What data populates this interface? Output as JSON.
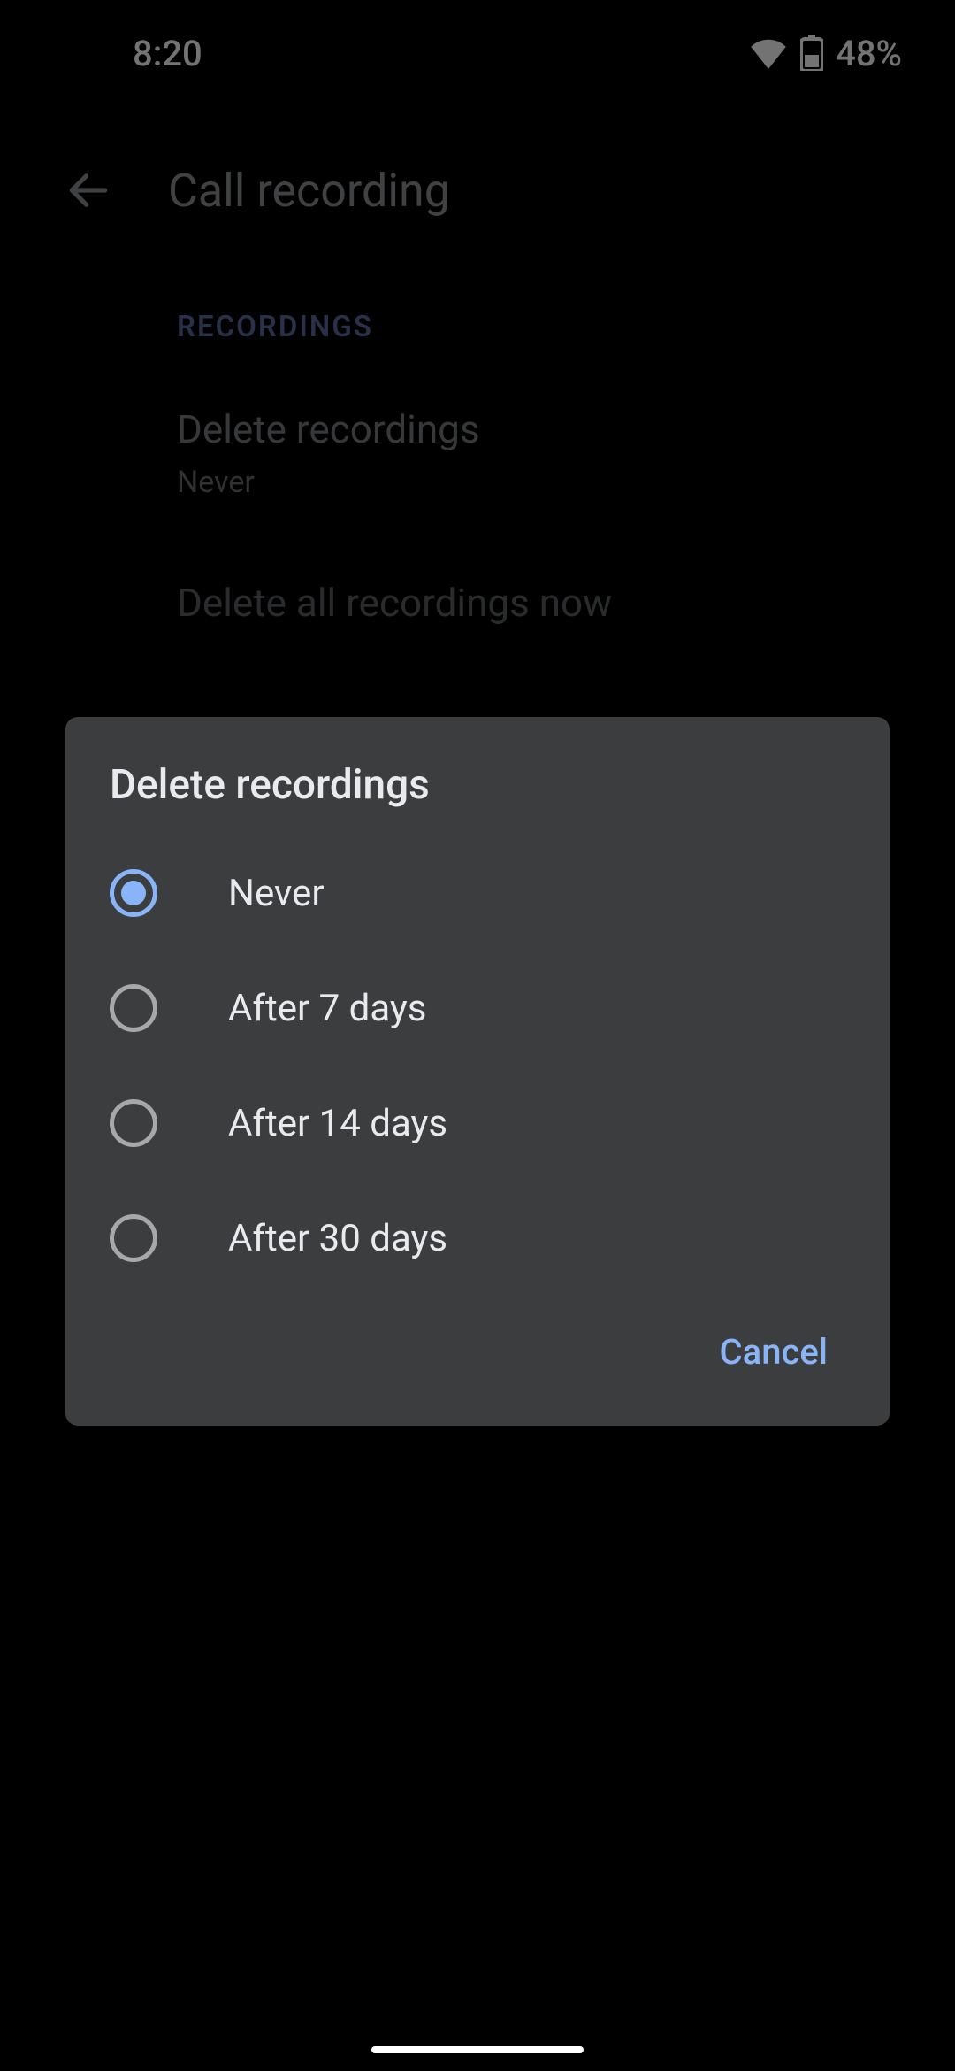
{
  "status": {
    "time": "8:20",
    "battery_pct": "48%"
  },
  "page": {
    "title": "Call recording",
    "section_header": "RECORDINGS",
    "items": [
      {
        "title": "Delete recordings",
        "sub": "Never"
      },
      {
        "title": "Delete all recordings now",
        "sub": ""
      }
    ]
  },
  "dialog": {
    "title": "Delete recordings",
    "options": [
      {
        "label": "Never",
        "selected": true
      },
      {
        "label": "After 7 days",
        "selected": false
      },
      {
        "label": "After 14 days",
        "selected": false
      },
      {
        "label": "After 30 days",
        "selected": false
      }
    ],
    "cancel": "Cancel"
  }
}
